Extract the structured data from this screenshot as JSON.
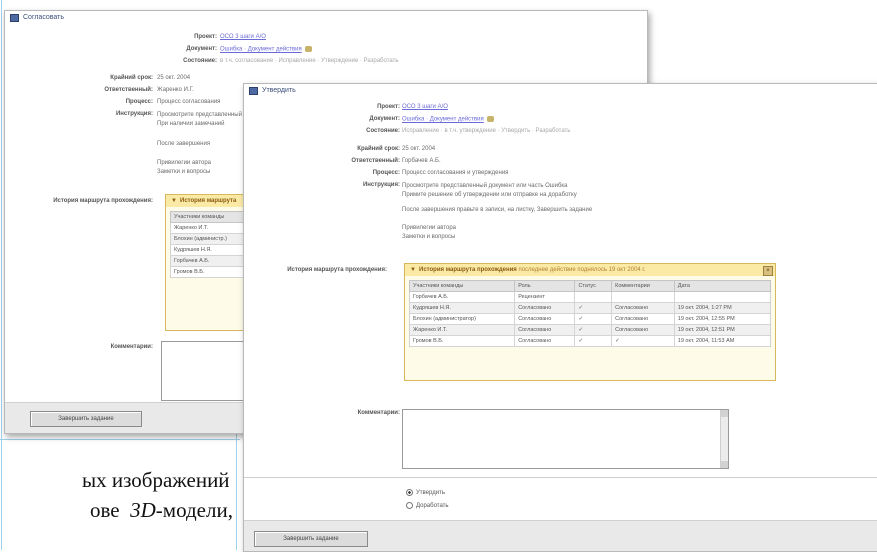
{
  "back_window": {
    "title": "Согласовать",
    "fields": [
      {
        "label": "Проект:",
        "value": "ОСО 3 шаги А/О",
        "style": "link"
      },
      {
        "label": "Документ:",
        "value": "Ошибка · Документ действия",
        "style": "link"
      },
      {
        "label": "Состояние:",
        "value": "в т.ч. согласование · Исправление · Утверждение · Разработать",
        "style": "dim"
      },
      {
        "label": "Крайний срок:",
        "value": "25 окт. 2004",
        "style": "plain"
      },
      {
        "label": "Ответственный:",
        "value": "Жаренко И.Г.",
        "style": "plain"
      },
      {
        "label": "Процесс:",
        "value": "Процесс согласования",
        "style": "plain"
      },
      {
        "label": "Инструкция:",
        "value": "Просмотрите представленный документ\nПри наличии замечаний",
        "style": "plain"
      }
    ],
    "extra_lines": [
      "После завершения",
      "Привилегии автора\nЗаметки и вопросы"
    ],
    "history_label": "История маршрута прохождения:",
    "panel_title": "История маршрута",
    "table_header": "Участники команды",
    "table_rows": [
      "Жаренко И.Т.",
      "Блохин (администр.)",
      "Кудряшев Н.Я.",
      "Горбачев А.Б.",
      "Громов В.Б."
    ],
    "comment_label": "Комментарии:",
    "button": "Завершить задание"
  },
  "front_window": {
    "title": "Утвердить",
    "fields": [
      {
        "label": "Проект:",
        "value": "ОСО 3 шаги А/О",
        "style": "link"
      },
      {
        "label": "Документ:",
        "value": "Ошибка · Документ действия",
        "style": "link"
      },
      {
        "label": "Состояние:",
        "value": "Исправление · в т.ч. утверждение · Утвердить · Разработать",
        "style": "dim"
      },
      {
        "label": "Крайний срок:",
        "value": "25 окт. 2004",
        "style": "plain"
      },
      {
        "label": "Ответственный:",
        "value": "Горбачев А.Б.",
        "style": "plain"
      },
      {
        "label": "Процесс:",
        "value": "Процесс согласования и утверждения",
        "style": "plain"
      },
      {
        "label": "Инструкция:",
        "value": "Просмотрите представленный документ или часть Ошибка\nПримите решение об утверждении или отправке на доработку",
        "style": "plain"
      }
    ],
    "extra_lines": [
      "После завершения правьте в записи, на листку, Завершить задание",
      "Привилегии автора\nЗаметки и вопросы"
    ],
    "history_label": "История маршрута прохождения:",
    "panel_title": "История маршрута прохождения",
    "panel_subtitle": "последнее действие поднялось 19 окт 2004 г.",
    "table_headers": [
      "Участники команды",
      "Роль",
      "Статус",
      "Комментарии",
      "Дата"
    ],
    "table_rows": [
      [
        "Горбачев А.Б.",
        "Рецензент",
        "",
        "",
        ""
      ],
      [
        "Кудряшев Н.Я.",
        "Согласовано",
        "✓",
        "Согласовано",
        "19 окт. 2004, 1:27 PM"
      ],
      [
        "Блохин (администратор)",
        "Согласовано",
        "✓",
        "Согласовано",
        "19 окт. 2004, 12:55 PM"
      ],
      [
        "Жаренко И.Т.",
        "Согласовано",
        "✓",
        "Согласовано",
        "19 окт. 2004, 12:51 PM"
      ],
      [
        "Громов В.Б.",
        "Согласовано",
        "✓",
        "✓",
        "19 окт. 2004, 11:53 AM"
      ]
    ],
    "comment_label": "Комментарии:",
    "radio_options": [
      "Утвердить",
      "Доработать"
    ],
    "button": "Завершить задание"
  },
  "caption": {
    "line1": "ых  изображений",
    "line2": "ове  3D-модели,"
  }
}
